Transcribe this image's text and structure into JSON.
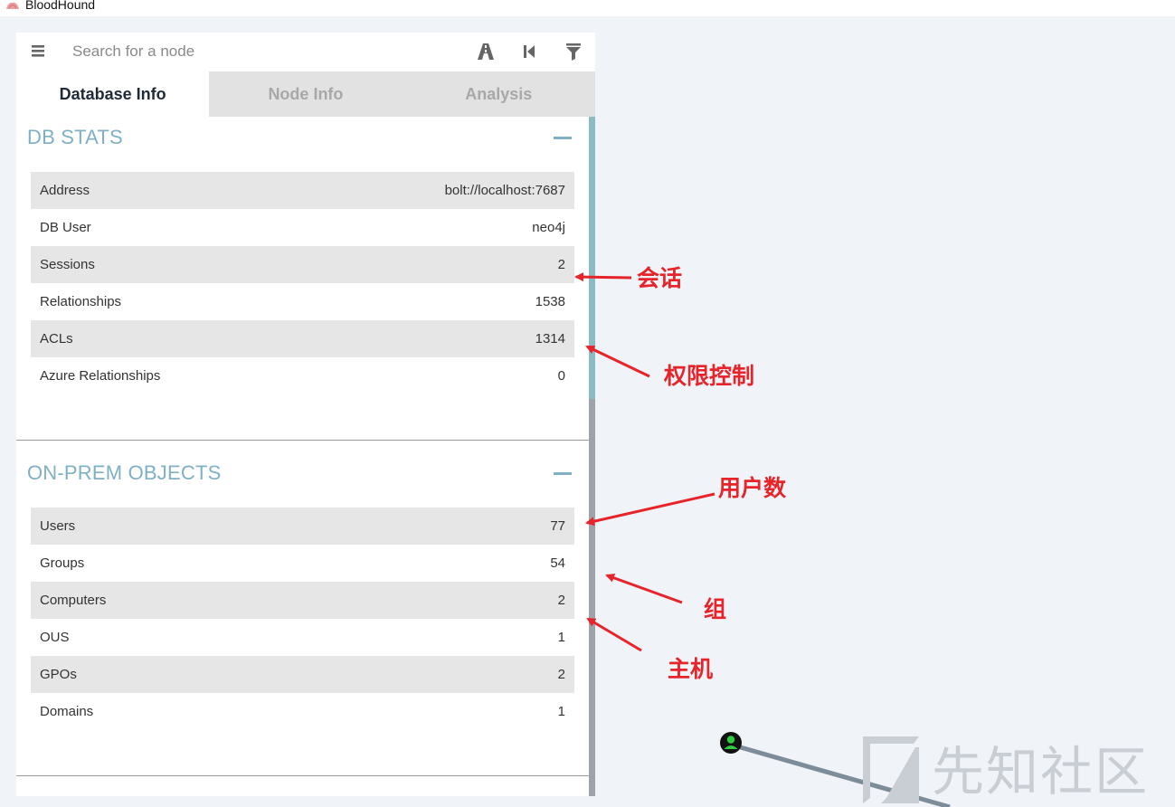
{
  "window": {
    "title": "BloodHound",
    "icon": "bloodhound-logo-icon"
  },
  "search": {
    "placeholder": "Search for a node",
    "value": "",
    "menu_icon": "hamburger-menu-icon",
    "tools": [
      "pathfinding-icon",
      "back-icon",
      "filter-icon"
    ]
  },
  "tabs": [
    {
      "label": "Database Info",
      "active": true
    },
    {
      "label": "Node Info",
      "active": false
    },
    {
      "label": "Analysis",
      "active": false
    }
  ],
  "db_stats": {
    "title": "DB STATS",
    "rows": [
      {
        "label": "Address",
        "value": "bolt://localhost:7687"
      },
      {
        "label": "DB User",
        "value": "neo4j"
      },
      {
        "label": "Sessions",
        "value": "2"
      },
      {
        "label": "Relationships",
        "value": "1538"
      },
      {
        "label": "ACLs",
        "value": "1314"
      },
      {
        "label": "Azure Relationships",
        "value": "0"
      }
    ]
  },
  "on_prem": {
    "title": "ON-PREM OBJECTS",
    "rows": [
      {
        "label": "Users",
        "value": "77"
      },
      {
        "label": "Groups",
        "value": "54"
      },
      {
        "label": "Computers",
        "value": "2"
      },
      {
        "label": "OUS",
        "value": "1"
      },
      {
        "label": "GPOs",
        "value": "2"
      },
      {
        "label": "Domains",
        "value": "1"
      }
    ]
  },
  "annotations": {
    "sessions": "会话",
    "acls": "权限控制",
    "users": "用户数",
    "groups": "组",
    "computers": "主机"
  },
  "watermark": {
    "text": "先知社区"
  },
  "colors": {
    "accent": "#7fb0c4",
    "annotation": "#e8242b",
    "node": "#2ecc40"
  }
}
